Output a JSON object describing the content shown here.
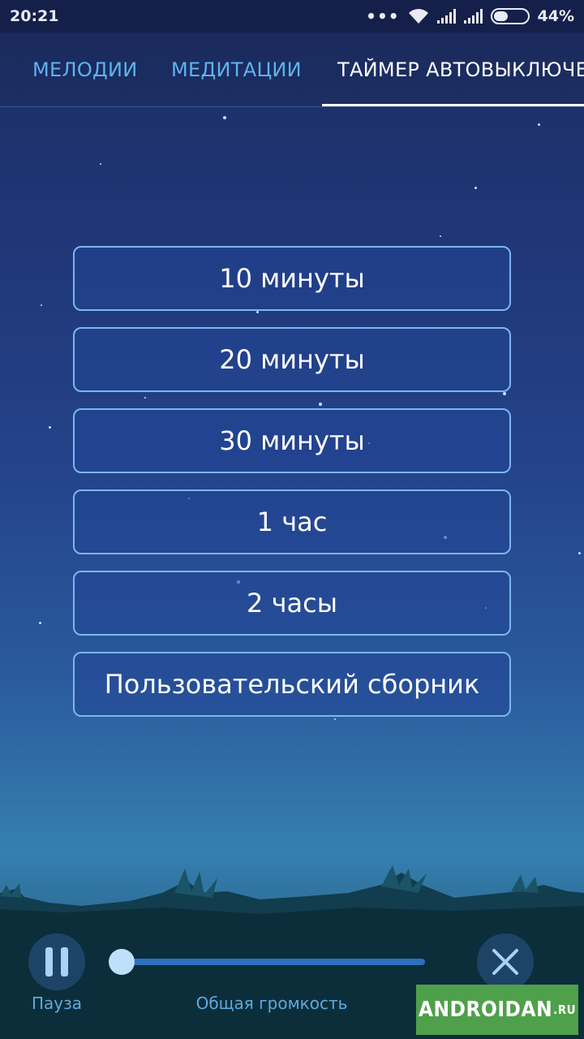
{
  "status_bar": {
    "time": "20:21",
    "icons": [
      "more-dots-icon",
      "wifi-icon",
      "signal-icon",
      "signal-icon",
      "battery-icon"
    ],
    "battery": "44%"
  },
  "tabs": [
    {
      "label": "МЕЛОДИИ",
      "active": false
    },
    {
      "label": "МЕДИТАЦИИ",
      "active": false
    },
    {
      "label": "ТАЙМЕР АВТОВЫКЛЮЧЕНИЯ",
      "active": true
    }
  ],
  "timer_options": [
    {
      "label": "10 минуты"
    },
    {
      "label": "20 минуты"
    },
    {
      "label": "30 минуты"
    },
    {
      "label": "1 час"
    },
    {
      "label": "2 часы"
    },
    {
      "label": "Пользовательский сборник"
    }
  ],
  "player": {
    "pause_label": "Пауза",
    "volume_label": "Общая громкость",
    "volume_level": 0.0
  },
  "watermark": {
    "main": "ANDROIDAN",
    "suffix": ".RU"
  },
  "colors": {
    "accent_tab": "#5fb3ee",
    "button_border": "#7cb6f0",
    "watermark_bg": "#4fa04a"
  }
}
